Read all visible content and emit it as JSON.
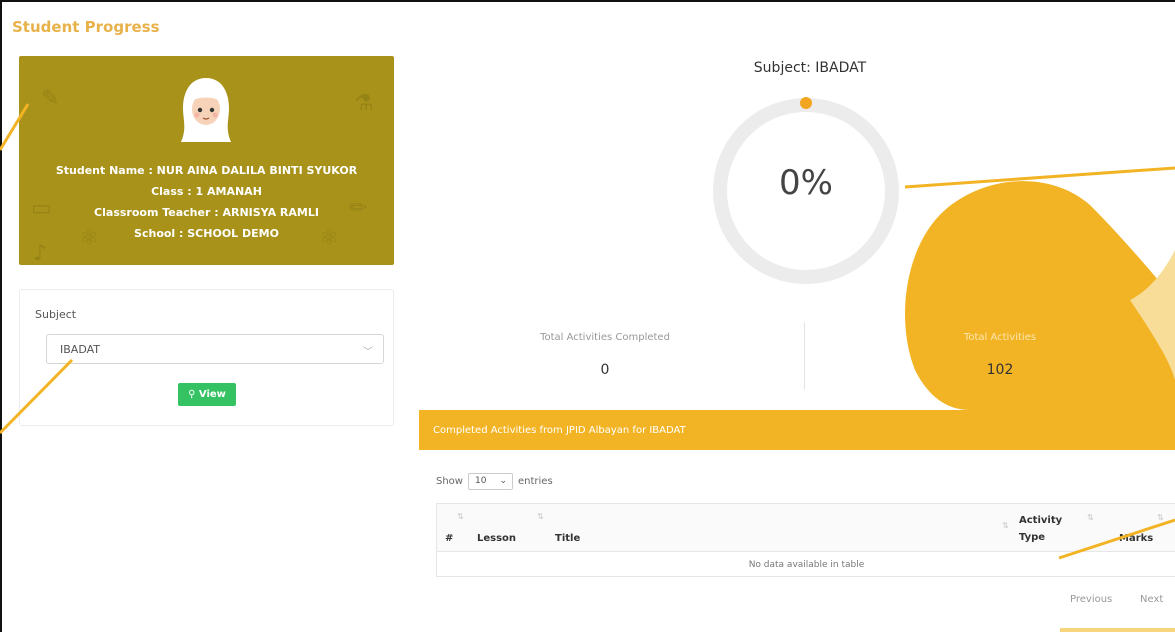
{
  "page": {
    "title": "Student Progress"
  },
  "student": {
    "name_line": "Student Name : NUR AINA DALILA BINTI SYUKOR",
    "class_line": "Class : 1 AMANAH",
    "teacher_line": "Classroom Teacher : ARNISYA RAMLI",
    "school_line": "School : SCHOOL DEMO"
  },
  "subject_filter": {
    "label": "Subject",
    "selected": "IBADAT",
    "view_label": "View"
  },
  "progress": {
    "heading": "Subject: IBADAT",
    "percent_text": "0%",
    "completed_label": "Total Activities Completed",
    "completed_value": "0",
    "total_label": "Total Activities",
    "total_value": "102"
  },
  "activities": {
    "bar_title": "Completed Activities from JPID Albayan for IBADAT",
    "show_label": "Show",
    "entries_value": "10",
    "entries_label": "entries",
    "columns": [
      "#",
      "Lesson",
      "Title",
      "Activity",
      "Type",
      "Marks"
    ],
    "empty_message": "No data available in table",
    "previous_label": "Previous",
    "next_label": "Next"
  },
  "colors": {
    "accent": "#f2b425",
    "card": "#a89219",
    "view_button": "#34c263",
    "title": "#e8b24a"
  }
}
